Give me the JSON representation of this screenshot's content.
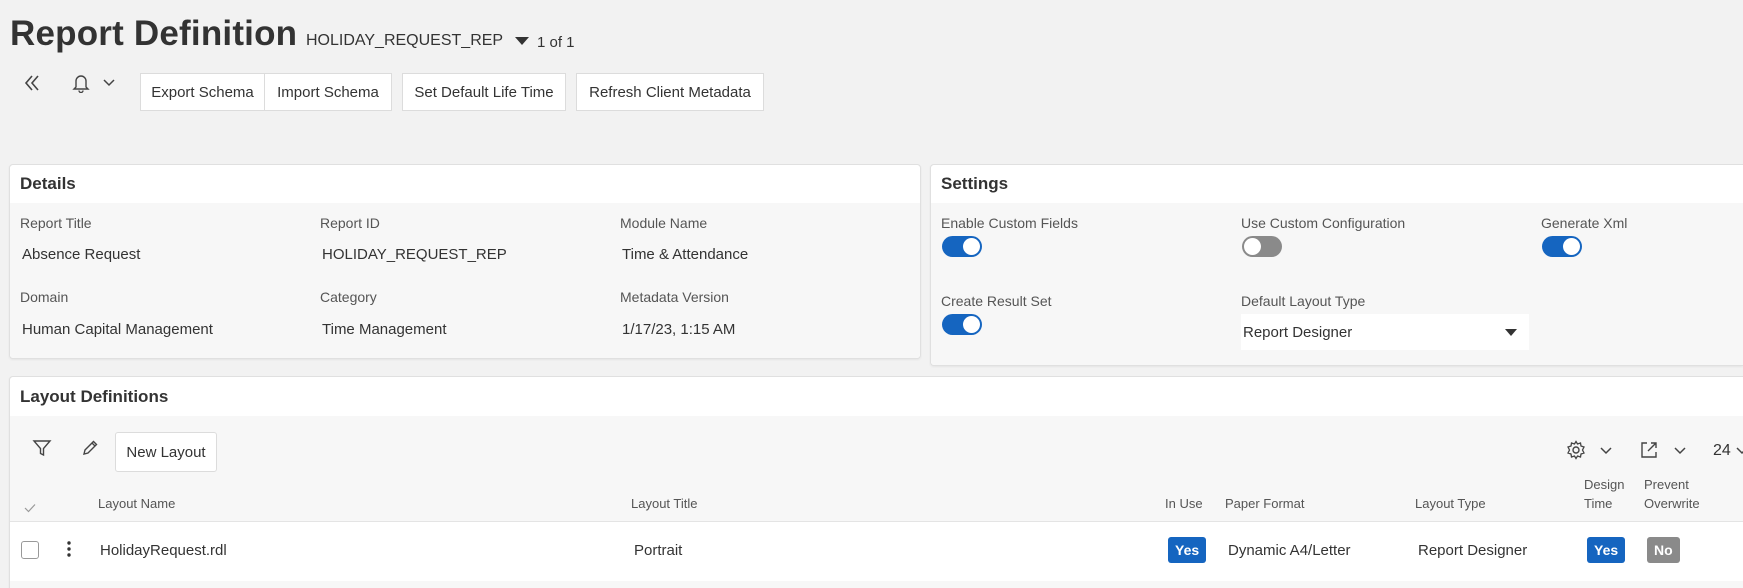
{
  "header": {
    "title": "Report Definition",
    "record": "HOLIDAY_REQUEST_REP",
    "record_count": "1 of 1"
  },
  "toolbar": {
    "export_schema": "Export Schema",
    "import_schema": "Import Schema",
    "set_default_life_time": "Set Default Life Time",
    "refresh_client_metadata": "Refresh Client Metadata"
  },
  "details": {
    "title": "Details",
    "fields": {
      "report_title": {
        "label": "Report Title",
        "value": "Absence Request"
      },
      "report_id": {
        "label": "Report ID",
        "value": "HOLIDAY_REQUEST_REP"
      },
      "module_name": {
        "label": "Module Name",
        "value": "Time & Attendance"
      },
      "domain": {
        "label": "Domain",
        "value": "Human Capital Management"
      },
      "category": {
        "label": "Category",
        "value": "Time Management"
      },
      "metadata_version": {
        "label": "Metadata Version",
        "value": "1/17/23, 1:15 AM"
      }
    }
  },
  "settings": {
    "title": "Settings",
    "enable_custom_fields": {
      "label": "Enable Custom Fields",
      "on": true
    },
    "use_custom_configuration": {
      "label": "Use Custom Configuration",
      "on": false
    },
    "generate_xml": {
      "label": "Generate Xml",
      "on": true
    },
    "create_result_set": {
      "label": "Create Result Set",
      "on": true
    },
    "default_layout_type": {
      "label": "Default Layout Type",
      "value": "Report Designer"
    }
  },
  "layout_definitions": {
    "title": "Layout Definitions",
    "new_layout_label": "New Layout",
    "page_size": "24",
    "columns": {
      "layout_name": "Layout Name",
      "layout_title": "Layout Title",
      "in_use": "In Use",
      "paper_format": "Paper Format",
      "layout_type": "Layout Type",
      "design_time_1": "Design",
      "design_time_2": "Time",
      "prevent_overwrite_1": "Prevent",
      "prevent_overwrite_2": "Overwrite"
    },
    "rows": [
      {
        "layout_name": "HolidayRequest.rdl",
        "layout_title": "Portrait",
        "in_use": "Yes",
        "paper_format": "Dynamic A4/Letter",
        "layout_type": "Report Designer",
        "design_time": "Yes",
        "prevent_overwrite": "No"
      }
    ]
  },
  "colors": {
    "accent": "#1565c0",
    "toggle_off": "#8a8a8a",
    "background": "#f2f2f2"
  }
}
